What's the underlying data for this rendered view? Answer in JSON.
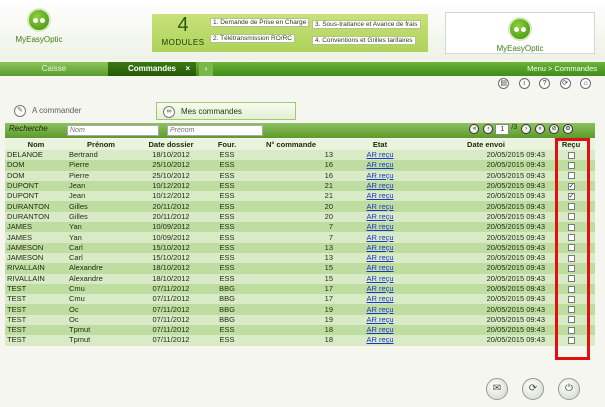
{
  "header": {
    "logo_left": "MyEasyOptic",
    "logo_right": "MyEasyOptic",
    "modules_count": "4",
    "modules_label": "MODULES",
    "modules": [
      "1. Demande de Prise en Charge",
      "2. Télétransmission RO/RC",
      "3. Sous-traitance et Avance de frais",
      "4. Conventions et Grilles tarifaires"
    ]
  },
  "tabs": {
    "caisse": "Caisse",
    "commandes": "Commandes",
    "close": "×",
    "more": "›"
  },
  "breadcrumb": "Menu > Commandes",
  "subtabs": {
    "a_commander": "A commander",
    "mes_commandes": "Mes commandes"
  },
  "search": {
    "label": "Recherche",
    "nom_placeholder": "Nom",
    "prenom_placeholder": "Prénom",
    "page": "1",
    "total": "/3"
  },
  "table": {
    "headers": [
      "Nom",
      "Prénom",
      "Date dossier",
      "Four.",
      "N° commande",
      "Etat",
      "Date envoi",
      "Reçu"
    ],
    "rows": [
      {
        "nom": "DELANOE",
        "prenom": "Bertrand",
        "date": "18/10/2012",
        "four": "ESS",
        "num": "13",
        "etat": "AR reçu",
        "envoi": "20/05/2015 09:43",
        "recu": ""
      },
      {
        "nom": "DOM",
        "prenom": "Pierre",
        "date": "25/10/2012",
        "four": "ESS",
        "num": "16",
        "etat": "AR reçu",
        "envoi": "20/05/2015 09:43",
        "recu": ""
      },
      {
        "nom": "DOM",
        "prenom": "Pierre",
        "date": "25/10/2012",
        "four": "ESS",
        "num": "16",
        "etat": "AR reçu",
        "envoi": "20/05/2015 09:43",
        "recu": ""
      },
      {
        "nom": "DUPONT",
        "prenom": "Jean",
        "date": "10/12/2012",
        "four": "ESS",
        "num": "21",
        "etat": "AR reçu",
        "envoi": "20/05/2015 09:43",
        "recu": "✓"
      },
      {
        "nom": "DUPONT",
        "prenom": "Jean",
        "date": "10/12/2012",
        "four": "ESS",
        "num": "21",
        "etat": "AR reçu",
        "envoi": "20/05/2015 09:43",
        "recu": "✓"
      },
      {
        "nom": "DURANTON",
        "prenom": "Gilles",
        "date": "20/11/2012",
        "four": "ESS",
        "num": "20",
        "etat": "AR reçu",
        "envoi": "20/05/2015 09:43",
        "recu": ""
      },
      {
        "nom": "DURANTON",
        "prenom": "Gilles",
        "date": "20/11/2012",
        "four": "ESS",
        "num": "20",
        "etat": "AR reçu",
        "envoi": "20/05/2015 09:43",
        "recu": ""
      },
      {
        "nom": "JAMES",
        "prenom": "Yan",
        "date": "10/09/2012",
        "four": "ESS",
        "num": "7",
        "etat": "AR reçu",
        "envoi": "20/05/2015 09:43",
        "recu": ""
      },
      {
        "nom": "JAMES",
        "prenom": "Yan",
        "date": "10/09/2012",
        "four": "ESS",
        "num": "7",
        "etat": "AR reçu",
        "envoi": "20/05/2015 09:43",
        "recu": ""
      },
      {
        "nom": "JAMESON",
        "prenom": "Carl",
        "date": "15/10/2012",
        "four": "ESS",
        "num": "13",
        "etat": "AR reçu",
        "envoi": "20/05/2015 09:43",
        "recu": ""
      },
      {
        "nom": "JAMESON",
        "prenom": "Carl",
        "date": "15/10/2012",
        "four": "ESS",
        "num": "13",
        "etat": "AR reçu",
        "envoi": "20/05/2015 09:43",
        "recu": ""
      },
      {
        "nom": "RIVALLAIN",
        "prenom": "Alexandre",
        "date": "18/10/2012",
        "four": "ESS",
        "num": "15",
        "etat": "AR reçu",
        "envoi": "20/05/2015 09:43",
        "recu": ""
      },
      {
        "nom": "RIVALLAIN",
        "prenom": "Alexandre",
        "date": "18/10/2012",
        "four": "ESS",
        "num": "15",
        "etat": "AR reçu",
        "envoi": "20/05/2015 09:43",
        "recu": ""
      },
      {
        "nom": "TEST",
        "prenom": "Cmu",
        "date": "07/11/2012",
        "four": "BBG",
        "num": "17",
        "etat": "AR reçu",
        "envoi": "20/05/2015 09:43",
        "recu": ""
      },
      {
        "nom": "TEST",
        "prenom": "Cmu",
        "date": "07/11/2012",
        "four": "BBG",
        "num": "17",
        "etat": "AR reçu",
        "envoi": "20/05/2015 09:43",
        "recu": ""
      },
      {
        "nom": "TEST",
        "prenom": "Oc",
        "date": "07/11/2012",
        "four": "BBG",
        "num": "19",
        "etat": "AR reçu",
        "envoi": "20/05/2015 09:43",
        "recu": ""
      },
      {
        "nom": "TEST",
        "prenom": "Oc",
        "date": "07/11/2012",
        "four": "BBG",
        "num": "19",
        "etat": "AR reçu",
        "envoi": "20/05/2015 09:43",
        "recu": ""
      },
      {
        "nom": "TEST",
        "prenom": "Tpmut",
        "date": "07/11/2012",
        "four": "ESS",
        "num": "18",
        "etat": "AR reçu",
        "envoi": "20/05/2015 09:43",
        "recu": ""
      },
      {
        "nom": "TEST",
        "prenom": "Tpmut",
        "date": "07/11/2012",
        "four": "ESS",
        "num": "18",
        "etat": "AR reçu",
        "envoi": "20/05/2015 09:43",
        "recu": ""
      }
    ]
  },
  "colors": {
    "accent": "#4f9a22",
    "highlight": "#e01010",
    "link": "#1a37c9"
  }
}
